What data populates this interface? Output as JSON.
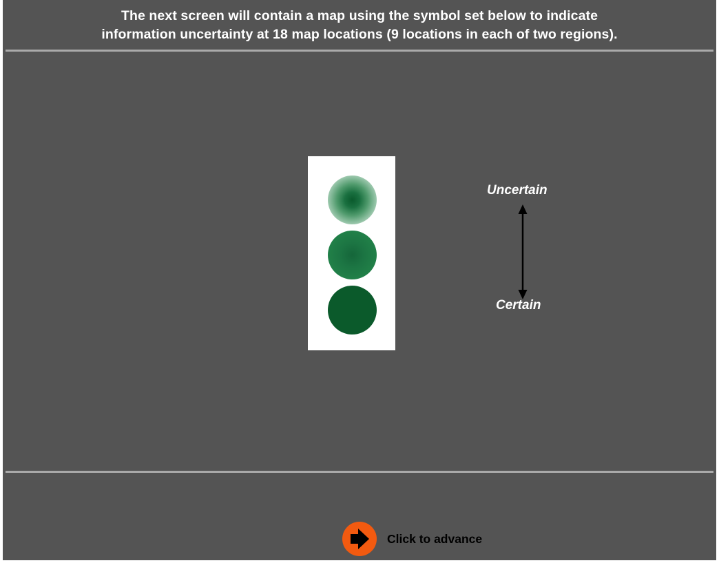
{
  "instructions": {
    "line1": "The next screen will contain a map using the symbol set below to indicate",
    "line2": "information uncertainty at 18 map locations (9 locations in each of two regions)."
  },
  "legend": {
    "symbol_color": "#0b5a2b",
    "symbols": [
      {
        "level": "uncertain",
        "style": "blurred"
      },
      {
        "level": "medium",
        "style": "slightly-blurred"
      },
      {
        "level": "certain",
        "style": "solid"
      }
    ],
    "scale_top_label": "Uncertain",
    "scale_bottom_label": "Certain",
    "scale_icon": "double-headed-arrow-icon"
  },
  "navigation": {
    "advance_label": "Click to advance",
    "advance_icon": "arrow-right-icon",
    "advance_color": "#f25a10"
  },
  "colors": {
    "background": "#545454",
    "divider": "#aaaaaa",
    "text": "#ffffff"
  }
}
